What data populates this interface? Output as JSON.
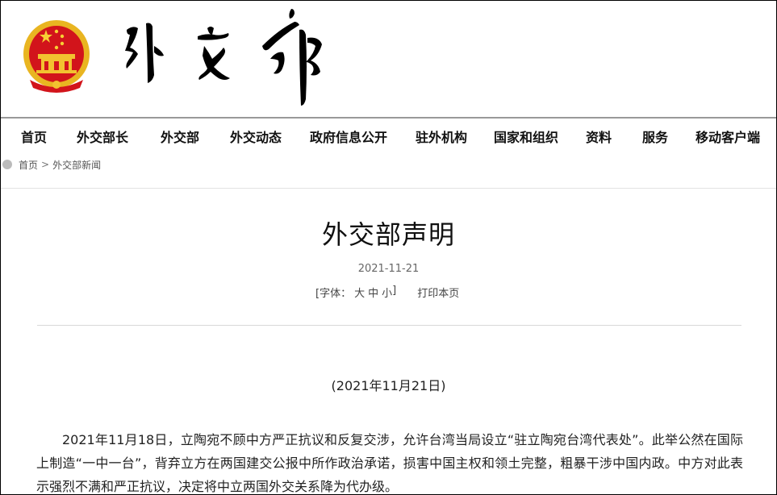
{
  "header": {
    "emblem": "national-emblem",
    "calligraphy_logo": "外交部"
  },
  "nav": {
    "items": [
      "首页",
      "外交部长",
      "外交部",
      "外交动态",
      "政府信息公开",
      "驻外机构",
      "国家和组织",
      "资料",
      "服务",
      "移动客户端"
    ]
  },
  "breadcrumb": {
    "home": "首页",
    "separator": ">",
    "current": "外交部新闻"
  },
  "article": {
    "title": "外交部声明",
    "date": "2021-11-21",
    "font_label": "[字体：",
    "font_large": "大",
    "font_medium": "中",
    "font_small": "小",
    "font_close": "]",
    "print": "打印本页",
    "subdate": "(2021年11月21日)",
    "body": "2021年11月18日，立陶宛不顾中方严正抗议和反复交涉，允许台湾当局设立“驻立陶宛台湾代表处”。此举公然在国际上制造“一中一台”，背弃立方在两国建交公报中所作政治承诺，损害中国主权和领土完整，粗暴干涉中国内政。中方对此表示强烈不满和严正抗议，决定将中立两国外交关系降为代办级。"
  },
  "colors": {
    "emblem_red": "#d2141b",
    "emblem_gold": "#f2c230"
  }
}
